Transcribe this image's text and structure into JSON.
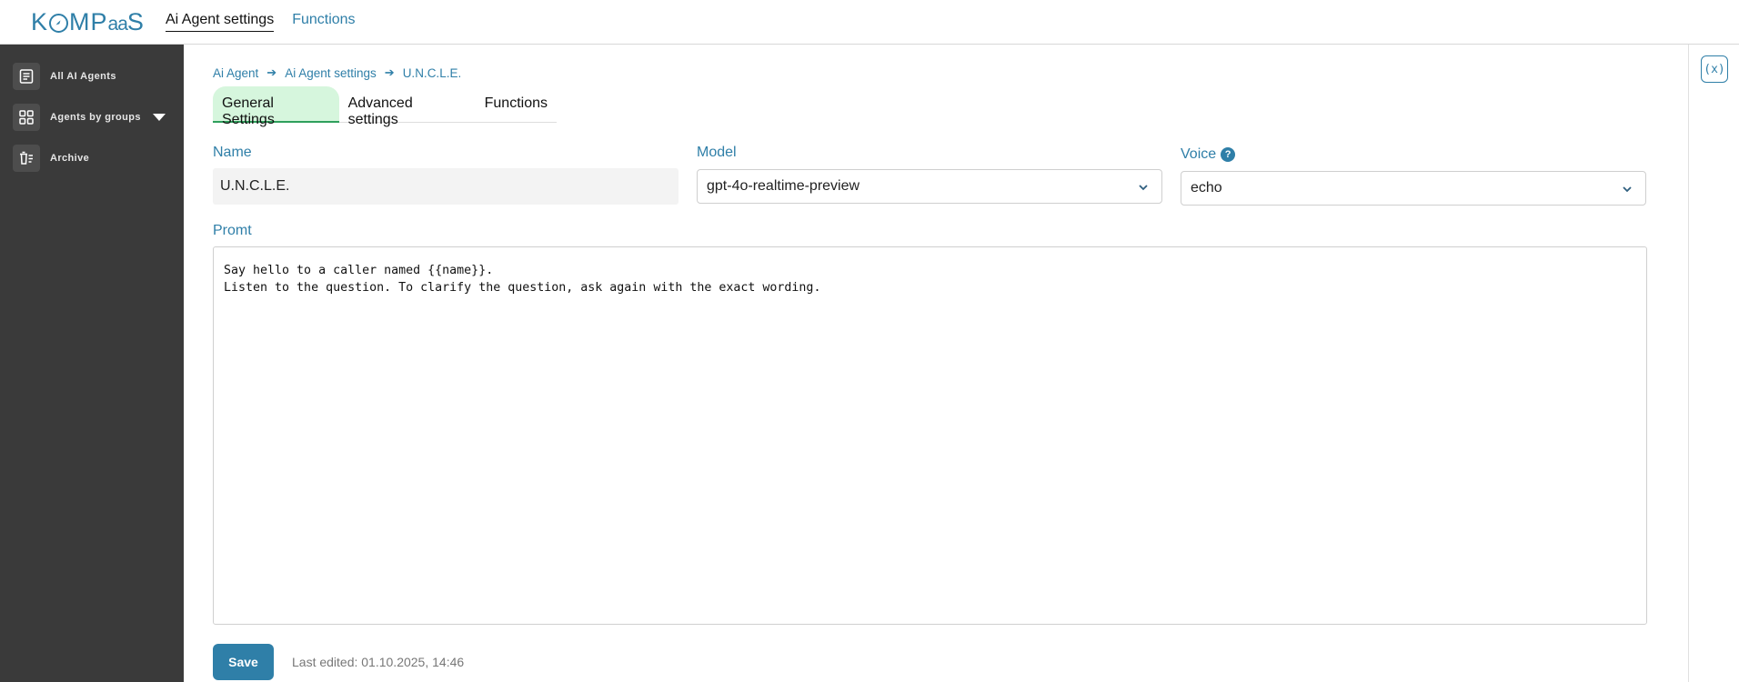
{
  "header": {
    "logo": {
      "k": "K",
      "o": "O",
      "mp": "MP",
      "aa": "aa",
      "s": "S"
    },
    "nav": [
      {
        "label": "Ai Agent settings"
      },
      {
        "label": "Functions"
      }
    ]
  },
  "sidebar": {
    "items": [
      {
        "label": "All AI Agents",
        "icon": "document-list-icon"
      },
      {
        "label": "Agents by groups",
        "icon": "grid-icon"
      },
      {
        "label": "Archive",
        "icon": "archive-icon"
      }
    ]
  },
  "breadcrumb": [
    "Ai Agent",
    "Ai Agent settings",
    "U.N.C.L.E."
  ],
  "tabs": [
    {
      "label": "General Settings"
    },
    {
      "label": "Advanced settings"
    },
    {
      "label": "Functions"
    }
  ],
  "form": {
    "name": {
      "label": "Name",
      "value": "U.N.C.L.E."
    },
    "model": {
      "label": "Model",
      "value": "gpt-4o-realtime-preview"
    },
    "voice": {
      "label": "Voice",
      "value": "echo",
      "help": "?"
    },
    "prompt": {
      "label": "Promt",
      "value": "Say hello to a caller named {{name}}.\nListen to the question. To clarify the question, ask again with the exact wording."
    }
  },
  "footer": {
    "save_label": "Save",
    "last_edited": "Last edited: 01.10.2025, 14:46"
  },
  "right_rail": {
    "button_glyph": "(x)"
  },
  "colors": {
    "accent": "#2f7fa8",
    "sidebar_bg": "#3a3a3a",
    "active_tab_bg": "#d6f6dd"
  }
}
